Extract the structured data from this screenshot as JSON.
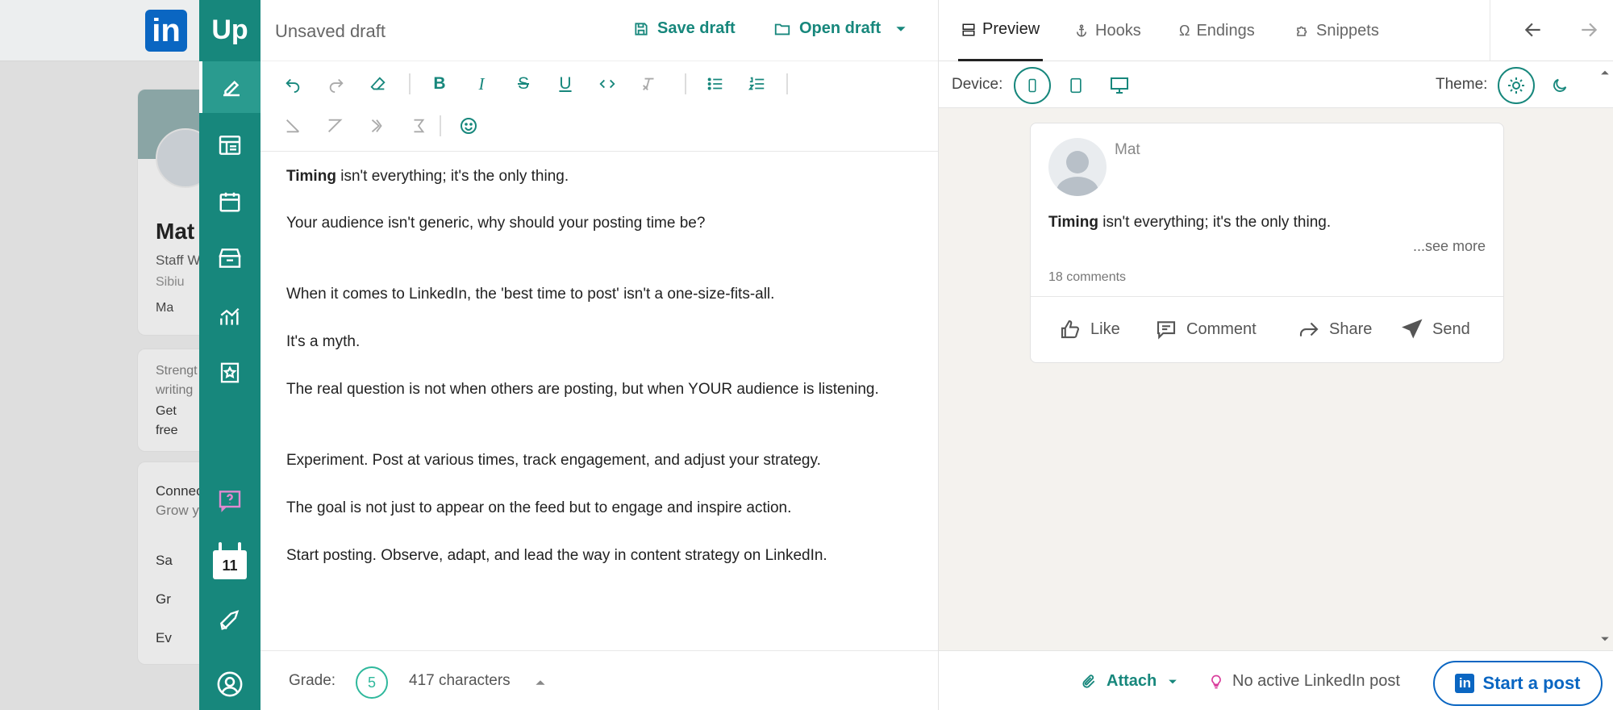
{
  "linkedin_bg": {
    "logo": "in",
    "profile": {
      "name": "Mat",
      "role": "Staff W",
      "location": "Sibiu",
      "org": "Ma"
    },
    "card2": {
      "line1": "Strengt",
      "line2": "writing",
      "line3": "Get",
      "line4": "free"
    },
    "card3": {
      "line1": "Connec",
      "line2": "Grow y",
      "item1": "Sa",
      "item2": "Gr",
      "item3": "Ev"
    }
  },
  "sidebar": {
    "logo": "Up",
    "items": [
      {
        "icon": "pen-icon",
        "active": true
      },
      {
        "icon": "drafts-icon"
      },
      {
        "icon": "calendar-icon"
      },
      {
        "icon": "archive-icon"
      },
      {
        "icon": "analytics-icon"
      },
      {
        "icon": "star-bookmark-icon"
      },
      {
        "icon": "help-icon"
      },
      {
        "icon": "rocket-icon"
      },
      {
        "icon": "profile-icon"
      }
    ],
    "calendar_day": "11"
  },
  "editor": {
    "draft_title": "Unsaved draft",
    "save_label": "Save draft",
    "open_label": "Open draft",
    "paragraphs": [
      {
        "bold": "Timing",
        "text": " isn't everything; it's the only thing."
      },
      {
        "bold": "",
        "text": "Your audience isn't generic, why should your posting time be?"
      },
      {
        "bold": "",
        "text": "When it comes to LinkedIn, the 'best time to post' isn't a one-size-fits-all."
      },
      {
        "bold": "",
        "text": "It's a myth."
      },
      {
        "bold": "",
        "text": "The real question is not when others are posting, but when YOUR audience is listening."
      },
      {
        "bold": "",
        "text": "Experiment. Post at various times, track engagement, and adjust your strategy."
      },
      {
        "bold": "",
        "text": "The goal is not just to appear on the feed but to engage and inspire action."
      },
      {
        "bold": "",
        "text": "Start posting. Observe, adapt, and lead the way in content strategy on LinkedIn."
      }
    ],
    "grade_label": "Grade:",
    "grade_value": "5",
    "char_count": "417 characters"
  },
  "preview": {
    "tabs": [
      {
        "label": "Preview",
        "icon": "layout-icon",
        "active": true
      },
      {
        "label": "Hooks",
        "icon": "anchor-icon"
      },
      {
        "label": "Endings",
        "icon": "omega-icon"
      },
      {
        "label": "Snippets",
        "icon": "puzzle-icon"
      }
    ],
    "device_label": "Device:",
    "theme_label": "Theme:",
    "post": {
      "author": "Mat",
      "bold": "Timing",
      "text": " isn't everything; it's the only thing.",
      "see_more": "...see more",
      "comments": "18 comments",
      "actions": [
        "Like",
        "Comment",
        "Share",
        "Send"
      ]
    },
    "attach_label": "Attach",
    "no_post_label": "No active LinkedIn post",
    "start_label": "Start a post"
  },
  "colors": {
    "brand": "#17877c",
    "linkedin": "#0a66c2",
    "grade": "#2fb89c"
  }
}
